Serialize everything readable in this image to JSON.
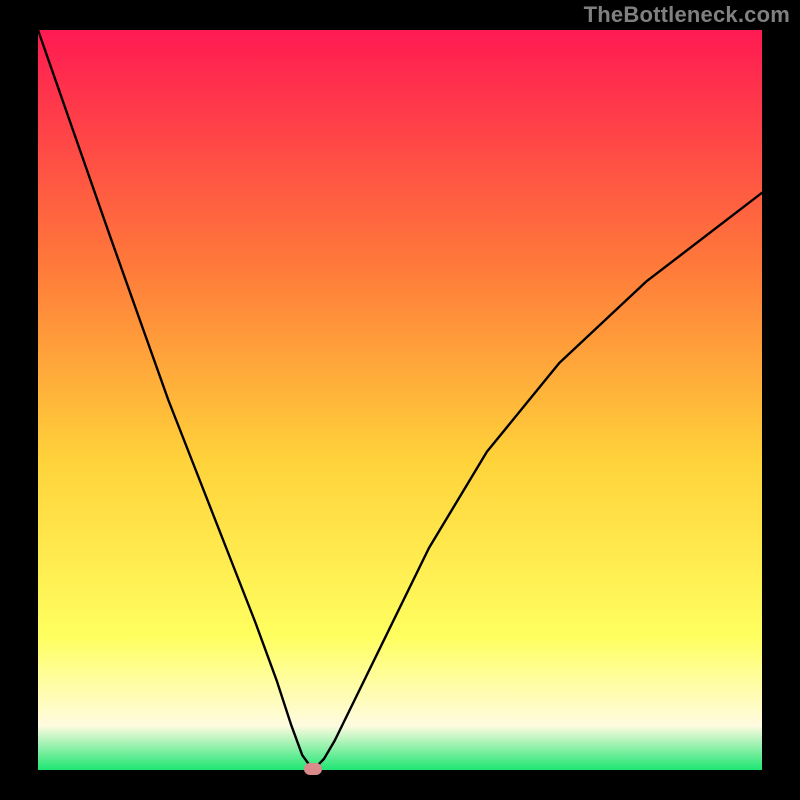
{
  "watermark": "TheBottleneck.com",
  "colors": {
    "frame": "#000000",
    "grad_top": "#ff1a52",
    "grad_upper_mid": "#ff7a3a",
    "grad_mid": "#ffd23a",
    "grad_lower_mid": "#ffff60",
    "grad_cream": "#fffbe0",
    "grad_bottom": "#1ee673",
    "curve": "#000000",
    "marker": "#d98a8a",
    "watermark_color": "#808080"
  },
  "chart_data": {
    "type": "line",
    "title": "",
    "xlabel": "",
    "ylabel": "",
    "xlim": [
      0,
      100
    ],
    "ylim": [
      0,
      100
    ],
    "grid": false,
    "legend": false,
    "notch_x": 38,
    "series": [
      {
        "name": "bottleneck-curve",
        "x": [
          0,
          5,
          10,
          14,
          18,
          22,
          26,
          30,
          33,
          35,
          36.5,
          38,
          39.5,
          41,
          44,
          48,
          54,
          62,
          72,
          84,
          100
        ],
        "values": [
          100,
          86,
          72,
          61,
          50,
          40,
          30,
          20,
          12,
          6,
          2,
          0,
          1.5,
          4,
          10,
          18,
          30,
          43,
          55,
          66,
          78
        ]
      }
    ],
    "markers": [
      {
        "name": "optimal-point",
        "x": 38,
        "y": 0
      }
    ]
  }
}
